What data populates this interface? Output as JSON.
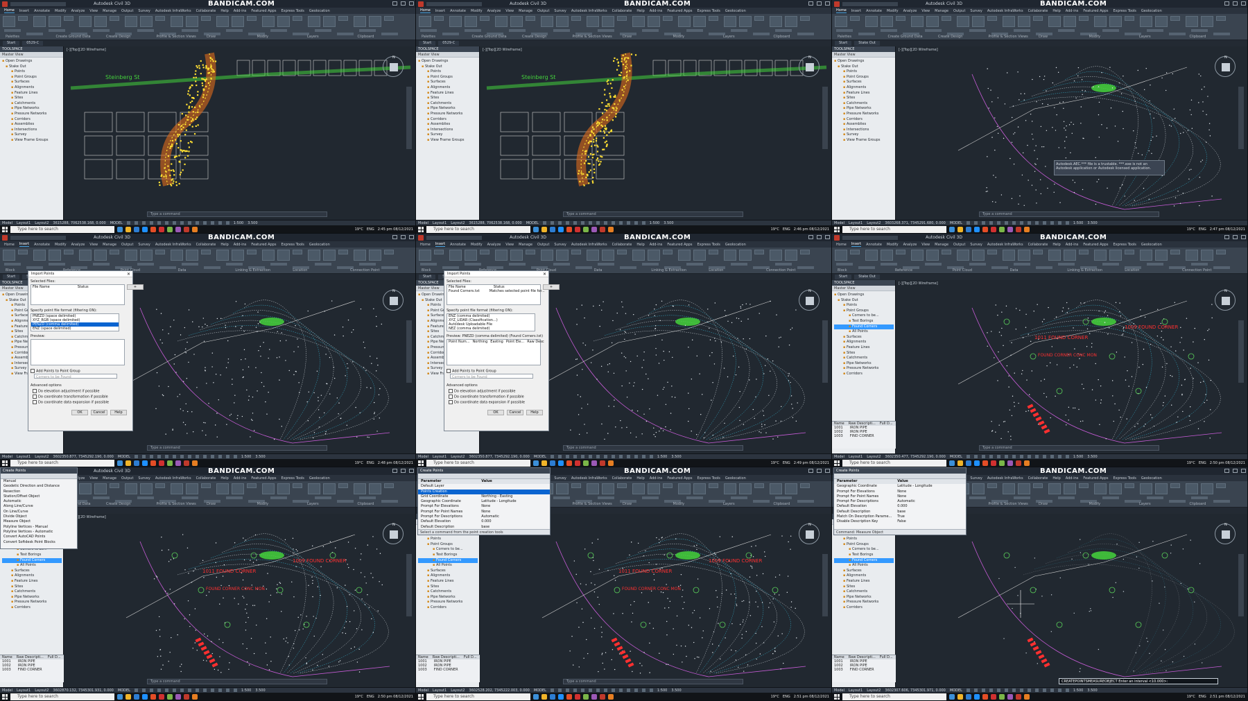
{
  "app": {
    "window_title": "Autodesk Civil 3D",
    "watermark": "BANDICAM.COM",
    "ribbon_tabs": [
      "Home",
      "Insert",
      "Annotate",
      "Modify",
      "Analyze",
      "View",
      "Manage",
      "Output",
      "Survey",
      "Autodesk InfraWorks",
      "Collaborate",
      "Help",
      "Add-ins",
      "Featured Apps",
      "Express Tools",
      "Geolocation"
    ],
    "insert_panels": [
      "Block",
      "Reference",
      "Point Cloud",
      "Data",
      "Linking & Extraction",
      "Location",
      "Connection Point"
    ],
    "home_panels": [
      "Palettes",
      "Create Ground Data",
      "Create Design",
      "Profile & Section Views",
      "Draw",
      "Modify",
      "Layers",
      "Clipboard"
    ],
    "document_tabs": [
      "Start",
      "Stake Out"
    ],
    "document_tabs_alt": [
      "Start",
      "0529-C"
    ],
    "viewport_label": "[-][Top][2D Wireframe]",
    "command_placeholder": "Type a command",
    "status_model": "MODEL",
    "layout_tabs": [
      "Model",
      "Layout1",
      "Layout2"
    ]
  },
  "toolspace": {
    "title": "TOOLSPACE",
    "view": "Master View",
    "tree_basic": [
      {
        "label": "Open Drawings",
        "lvl": 0
      },
      {
        "label": "Stake Out",
        "lvl": 1
      },
      {
        "label": "Points",
        "lvl": 2
      },
      {
        "label": "Point Groups",
        "lvl": 2
      },
      {
        "label": "Surfaces",
        "lvl": 2
      },
      {
        "label": "Alignments",
        "lvl": 2
      },
      {
        "label": "Feature Lines",
        "lvl": 2
      },
      {
        "label": "Sites",
        "lvl": 2
      },
      {
        "label": "Catchments",
        "lvl": 2
      },
      {
        "label": "Pipe Networks",
        "lvl": 2
      },
      {
        "label": "Pressure Networks",
        "lvl": 2
      },
      {
        "label": "Corridors",
        "lvl": 2
      },
      {
        "label": "Assemblies",
        "lvl": 2
      },
      {
        "label": "Intersections",
        "lvl": 2
      },
      {
        "label": "Survey",
        "lvl": 2
      },
      {
        "label": "View Frame Groups",
        "lvl": 2
      }
    ],
    "tree_groups": [
      {
        "label": "Open Drawings",
        "lvl": 0
      },
      {
        "label": "Stake Out",
        "lvl": 1
      },
      {
        "label": "Points",
        "lvl": 2
      },
      {
        "label": "Point Groups",
        "lvl": 2
      },
      {
        "label": "Corners to be...",
        "lvl": 3
      },
      {
        "label": "Test Borings",
        "lvl": 3
      },
      {
        "label": "Found Corners",
        "lvl": 3,
        "sel": true
      },
      {
        "label": "All Points",
        "lvl": 3
      },
      {
        "label": "Surfaces",
        "lvl": 2
      },
      {
        "label": "Alignments",
        "lvl": 2
      },
      {
        "label": "Feature Lines",
        "lvl": 2
      },
      {
        "label": "Sites",
        "lvl": 2
      },
      {
        "label": "Catchments",
        "lvl": 2
      },
      {
        "label": "Pipe Networks",
        "lvl": 2
      },
      {
        "label": "Pressure Networks",
        "lvl": 2
      },
      {
        "label": "Corridors",
        "lvl": 2
      }
    ]
  },
  "import_dialog": {
    "title": "Import Points",
    "selected_files": "Selected Files:",
    "col_file": "File Name",
    "col_status": "Status",
    "format_label": "Specify point file format (filtering ON):",
    "formats": [
      "PNEZD (space delimited)",
      "XYZ_RGB (space delimited)",
      "PENZD (comma delimited)",
      "ENZ (space delimited)"
    ],
    "formats_b": [
      "ENZ (comma delimited)",
      "XYZ_LIDAR (Classification...)",
      "Autodesk Uploadable File",
      "NEZ (comma delimited)"
    ],
    "preview": "Preview:",
    "preview_b": "Preview: PNEZD (comma delimited) (Found Corners.txt)",
    "file_b": "Found Corners.txt",
    "status_b": "Matches selected point file for...",
    "preview_cols": [
      "Point Num...",
      "Northing",
      "Easting",
      "Point Ele...",
      "Raw Desc"
    ],
    "add_group": "Add Points to Point Group",
    "group_placeholder": "Corners to be Found",
    "advanced": "Advanced options",
    "opt1": "Do elevation adjustment if possible",
    "opt2": "Do coordinate transformation if possible",
    "opt3": "Do coordinate data expansion if possible",
    "ok": "OK",
    "cancel": "Cancel",
    "help": "Help"
  },
  "create_points": {
    "title": "Create Points",
    "menu": [
      "Manual",
      "Geodetic Direction and Distance",
      "Resection",
      "Station/Offset Object",
      "Automatic",
      "Along Line/Curve",
      "On Line/Curve",
      "Divide Object",
      "Measure Object",
      "Polyline Vertices - Manual",
      "Polyline Vertices - Automatic",
      "Convert AutoCAD Points",
      "Convert Softdesk Point Blocks"
    ],
    "param_header": [
      "Parameter",
      "Value"
    ],
    "params": [
      [
        "Default Layer",
        ""
      ],
      [
        "Points Creation",
        ""
      ],
      [
        "Grid Coordinate",
        "Northing - Easting"
      ],
      [
        "Geographic Coordinate",
        "Latitude - Longitude"
      ],
      [
        "Prompt For Elevations",
        "None"
      ],
      [
        "Prompt For Point Names",
        "None"
      ],
      [
        "Prompt For Descriptions",
        "Automatic"
      ],
      [
        "Default Elevation",
        "0.000"
      ],
      [
        "Default Description",
        "base"
      ],
      [
        "Match On Description Parame...",
        "True"
      ],
      [
        "Disable Description Key",
        "False"
      ]
    ],
    "footer": "Select a command from the point creation tools",
    "footer_b": "Command: Measure Object"
  },
  "points_list": {
    "cols": [
      "Name",
      "Raw Descripti...",
      "Full D..."
    ],
    "rows": [
      [
        "1001",
        "IRON PIPE"
      ],
      [
        "1002",
        "IRON PIPE"
      ],
      [
        "1003",
        "FIND CORNER"
      ]
    ]
  },
  "labels": {
    "street": "Steinberg St",
    "found_corner_1": "1009 FOUND CORNER",
    "found_corner_2": "1011 FOUND CORNER",
    "found_corner_3": "FOUND CORNER CONC MON",
    "tooltip": "Autodesk.AEC.*** file is a trustable. ***.exe is not an Autodesk application or Autodesk licensed application.",
    "cmd_measure": "CREATEPOINTSMEASUREOBJECT Enter an interval <10.000>:"
  },
  "statusbar": {
    "coords": [
      "3615288, 7062538.168, 0.000",
      "3615288, 7062538.168, 0.000",
      "3603268.371, 7345291.680, 0.000",
      "3602350.877, 7345292.190, 0.000",
      "3602350.877, 7345292.190, 0.000",
      "3602350.477, 7345292.190, 0.000",
      "3602870.132, 7345301.931, 0.000",
      "3602528.202, 7345222.003, 0.000",
      "3602307.606, 7345301.971, 0.000"
    ],
    "scale": "1:500",
    "val": "3.500"
  },
  "taskbar": {
    "search": "Type here to search",
    "weather": "19°C",
    "lang": "ENG",
    "times": [
      "2:45 pm",
      "2:46 pm",
      "2:47 pm",
      "2:48 pm",
      "2:49 pm",
      "2:50 pm",
      "2:50 pm",
      "2:51 pm",
      "2:51 pm"
    ],
    "date": "08/12/2021"
  },
  "colors": {
    "ui_dark": "#2b3440",
    "viewport": "#212830",
    "survey_points": "#ffe033",
    "contours_cyan": "#38c7e8",
    "contours_white": "#e8eef3",
    "vegetation": "#44d23c",
    "found_corners": "#ff3030",
    "parcels": "#d2d2d2",
    "magenta": "#c85cd8"
  }
}
